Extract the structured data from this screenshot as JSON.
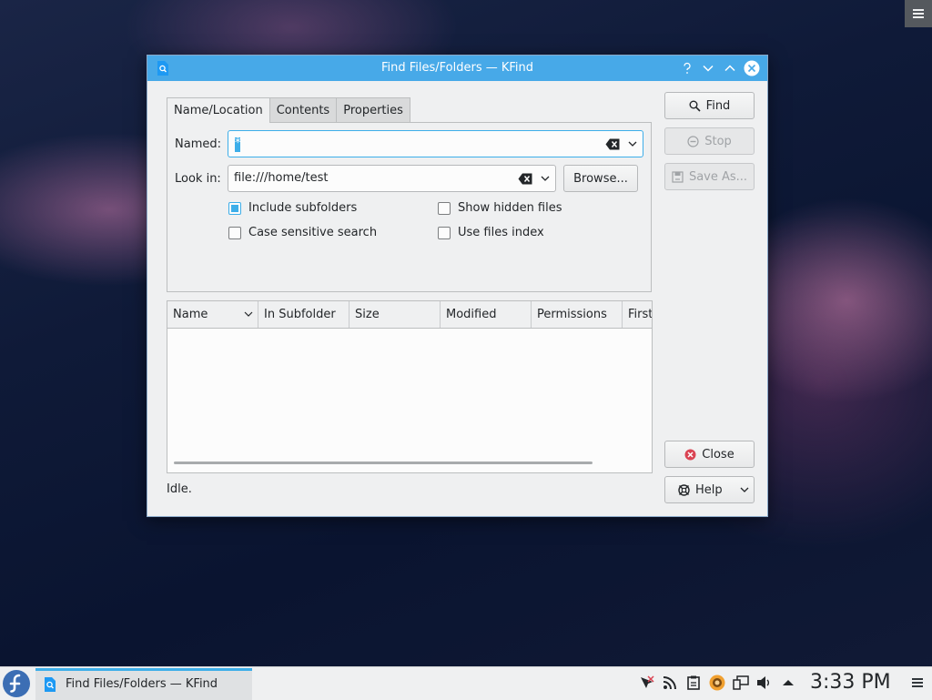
{
  "window": {
    "title": "Find Files/Folders — KFind"
  },
  "tabs": [
    {
      "label": "Name/Location",
      "active": true
    },
    {
      "label": "Contents",
      "active": false
    },
    {
      "label": "Properties",
      "active": false
    }
  ],
  "form": {
    "named_label": "Named:",
    "named_value": "*",
    "lookin_label": "Look in:",
    "lookin_value": "file:///home/test",
    "browse_label": "Browse...",
    "checkboxes": {
      "include_subfolders": {
        "label": "Include subfolders",
        "checked": true
      },
      "case_sensitive": {
        "label": "Case sensitive search",
        "checked": false
      },
      "show_hidden": {
        "label": "Show hidden files",
        "checked": false
      },
      "use_index": {
        "label": "Use files index",
        "checked": false
      }
    }
  },
  "results": {
    "columns": [
      "Name",
      "In Subfolder",
      "Size",
      "Modified",
      "Permissions",
      "First"
    ],
    "rows": []
  },
  "status": "Idle.",
  "actions": {
    "find": "Find",
    "stop": "Stop",
    "save_as": "Save As...",
    "close": "Close",
    "help": "Help"
  },
  "taskbar": {
    "task_label": "Find Files/Folders — KFind",
    "clock": "3:33 PM"
  },
  "colors": {
    "accent": "#3daee9",
    "titlebar": "#47a9e8",
    "close_red": "#da4453"
  }
}
